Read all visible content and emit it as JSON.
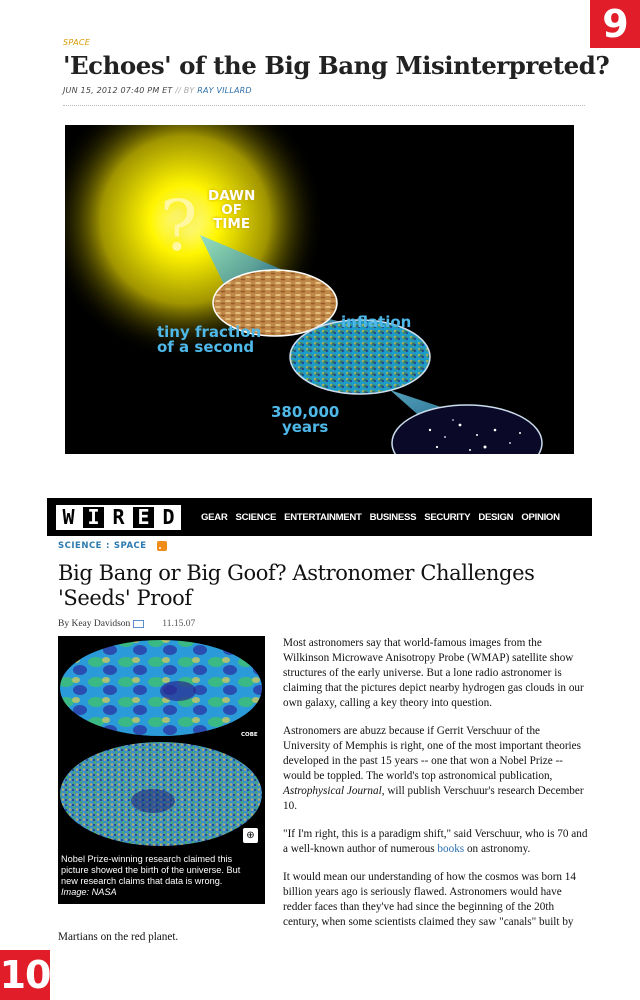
{
  "badges": {
    "top": "9",
    "bottom": "10"
  },
  "article1": {
    "category": "SPACE",
    "title": "'Echoes' of the Big Bang Misinterpreted?",
    "date": "JUN 15, 2012 07:40 PM ET",
    "sep": " // BY ",
    "author": "RAY VILLARD",
    "image_labels": {
      "question": "?",
      "dawn": [
        "DAWN",
        "OF",
        "TIME"
      ],
      "inflation": "inflation",
      "tiny": [
        "tiny fraction",
        "of a second"
      ],
      "years": [
        "380,000",
        "years"
      ]
    }
  },
  "wired": {
    "logo": [
      "W",
      "I",
      "R",
      "E",
      "D"
    ],
    "nav": [
      "GEAR",
      "SCIENCE",
      "ENTERTAINMENT",
      "BUSINESS",
      "SECURITY",
      "DESIGN",
      "OPINION"
    ]
  },
  "article2": {
    "crumb1": "SCIENCE",
    "crumb_sep": ":",
    "crumb2": "SPACE",
    "title_line1": "Big Bang or Big Goof? Astronomer Challenges",
    "title_line2": "'Seeds' Proof",
    "byline": "By Keay Davidson",
    "date": "11.15.07",
    "figure": {
      "cobe": "COBE",
      "zoom": "⊕",
      "caption": "Nobel Prize-winning research claimed this picture showed the birth of the universe. But new research claims that data is wrong.",
      "credit": "Image: NASA"
    },
    "p1": "Most astronomers say that world-famous images from the Wilkinson Microwave Anisotropy Probe (WMAP) satellite show structures of the early universe. But a lone radio astronomer is claiming that the pictures depict nearby hydrogen gas clouds in our own galaxy, calling a key theory into question.",
    "p2a": "Astronomers are abuzz because if Gerrit Verschuur of the University of Memphis is right, one of the most important theories developed in the past 15 years -- one that won a Nobel Prize -- would be toppled. The world's top astronomical publication, ",
    "p2i": "Astrophysical Journal",
    "p2b": ", will publish Verschuur's research December 10.",
    "p3a": "\"If I'm right, this is a paradigm shift,\" said Verschuur, who is 70 and a well-known author of numerous ",
    "p3link": "books",
    "p3b": " on astronomy.",
    "p4": "It would mean our understanding of how the cosmos was born 14 billion years ago is seriously flawed. Astronomers would have redder faces than they've had since the beginning of the 20th century, when some scientists claimed they saw \"canals\" built by Martians on the red planet."
  }
}
